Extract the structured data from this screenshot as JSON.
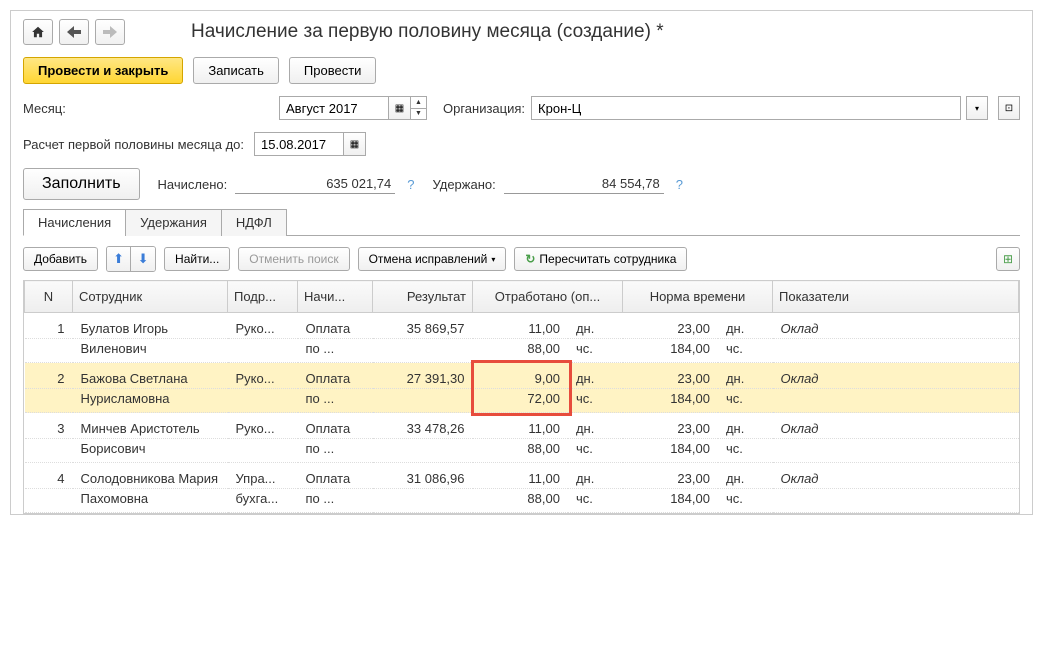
{
  "header": {
    "title": "Начисление за первую половину месяца (создание) *"
  },
  "buttons": {
    "primary": "Провести и закрыть",
    "save": "Записать",
    "post": "Провести"
  },
  "form": {
    "month_label": "Месяц:",
    "month_value": "Август 2017",
    "org_label": "Организация:",
    "org_value": "Крон-Ц",
    "calc_label": "Расчет первой половины месяца до:",
    "calc_value": "15.08.2017",
    "fill_btn": "Заполнить",
    "accrued_label": "Начислено:",
    "accrued_value": "635 021,74",
    "withheld_label": "Удержано:",
    "withheld_value": "84 554,78"
  },
  "tabs": [
    "Начисления",
    "Удержания",
    "НДФЛ"
  ],
  "toolbar": {
    "add": "Добавить",
    "find": "Найти...",
    "cancel_search": "Отменить поиск",
    "cancel_corrections": "Отмена исправлений",
    "recalc": "Пересчитать сотрудника"
  },
  "columns": [
    "N",
    "Сотрудник",
    "Подр...",
    "Начи...",
    "Результат",
    "Отработано (оп...",
    "Норма времени",
    "Показатели"
  ],
  "units": {
    "days": "дн.",
    "hours": "чс."
  },
  "rows": [
    {
      "n": "1",
      "emp": "Булатов Игорь Виленович",
      "dep": "Руко...",
      "acc": "Оплата по ...",
      "res": "35 869,57",
      "wd": "11,00",
      "wh": "88,00",
      "nd": "23,00",
      "nh": "184,00",
      "ind": "Оклад",
      "sel": false
    },
    {
      "n": "2",
      "emp": "Бажова Светлана Нурисламовна",
      "dep": "Руко...",
      "acc": "Оплата по ...",
      "res": "27 391,30",
      "wd": "9,00",
      "wh": "72,00",
      "nd": "23,00",
      "nh": "184,00",
      "ind": "Оклад",
      "sel": true
    },
    {
      "n": "3",
      "emp": "Минчев Аристотель Борисович",
      "dep": "Руко...",
      "acc": "Оплата по ...",
      "res": "33 478,26",
      "wd": "11,00",
      "wh": "88,00",
      "nd": "23,00",
      "nh": "184,00",
      "ind": "Оклад",
      "sel": false
    },
    {
      "n": "4",
      "emp": "Солодовникова Мария Пахомовна",
      "dep": "Упра... бухга...",
      "acc": "Оплата по ...",
      "res": "31 086,96",
      "wd": "11,00",
      "wh": "88,00",
      "nd": "23,00",
      "nh": "184,00",
      "ind": "Оклад",
      "sel": false
    }
  ]
}
